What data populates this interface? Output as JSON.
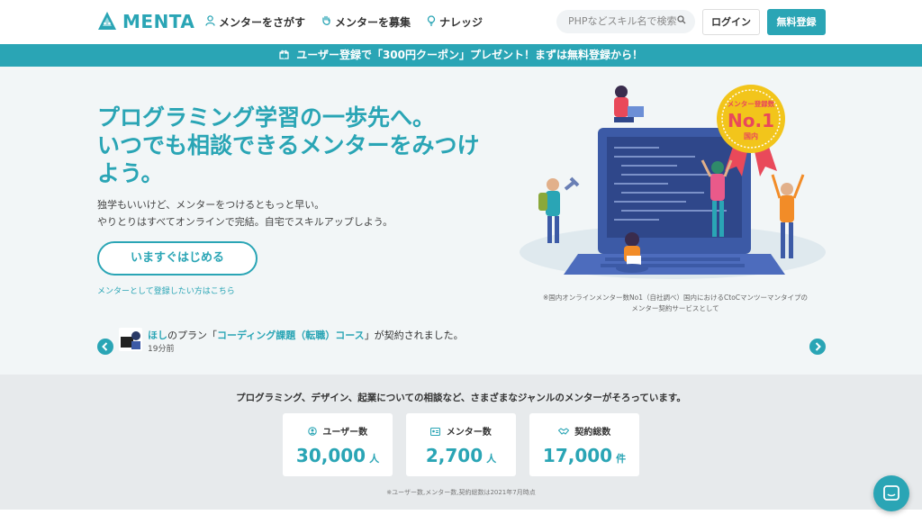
{
  "header": {
    "logo_text": "MENTA",
    "nav": [
      {
        "label": "メンターをさがす",
        "icon": "person-icon"
      },
      {
        "label": "メンターを募集",
        "icon": "hand-icon"
      },
      {
        "label": "ナレッジ",
        "icon": "bulb-icon"
      }
    ],
    "search_placeholder": "PHPなどスキル名で検索",
    "login_label": "ログイン",
    "signup_label": "無料登録"
  },
  "banner": {
    "text": "ユーザー登録で「300円クーポン」プレゼント！まずは無料登録から！"
  },
  "hero": {
    "title_lines": [
      "プログラミング学習の一歩先へ。",
      "いつでも相談できるメンターをみつけ",
      "よう。"
    ],
    "subtitle_lines": [
      "独学もいいけど、メンターをつけるともっと早い。",
      "やりとりはすべてオンラインで完結。自宅でスキルアップしよう。"
    ],
    "cta_label": "いますぐはじめる",
    "mentor_link": "メンターとして登録したい方はこちら",
    "badge": {
      "top": "メンター登録数",
      "main": "No.1",
      "bottom": "国内"
    },
    "illustration_note_lines": [
      "※国内オンラインメンター数No1（自社調べ）国内におけるCtoCマンツーマンタイプの",
      "メンター契約サービスとして"
    ]
  },
  "ticker": {
    "user": "ほし",
    "text_mid": "のプラン「",
    "plan": "コーディング課題（転職）コース",
    "text_end": "」が契約されました。",
    "time": "19分前"
  },
  "stats": {
    "lead": "プログラミング、デザイン、起業についての相談など、さまざまなジャンルのメンターがそろっています。",
    "cards": [
      {
        "label": "ユーザー数",
        "value": "30,000",
        "unit": "人",
        "icon": "user-circle-icon"
      },
      {
        "label": "メンター数",
        "value": "2,700",
        "unit": "人",
        "icon": "id-card-icon"
      },
      {
        "label": "契約総数",
        "value": "17,000",
        "unit": "件",
        "icon": "handshake-icon"
      }
    ],
    "note": "※ユーザー数,メンター数,契約総数は2021年7月時点"
  },
  "colors": {
    "accent": "#2aa5b5",
    "badge_gold": "#f2c51b",
    "badge_red": "#e9495a",
    "laptop_blue": "#3c5aa6"
  }
}
